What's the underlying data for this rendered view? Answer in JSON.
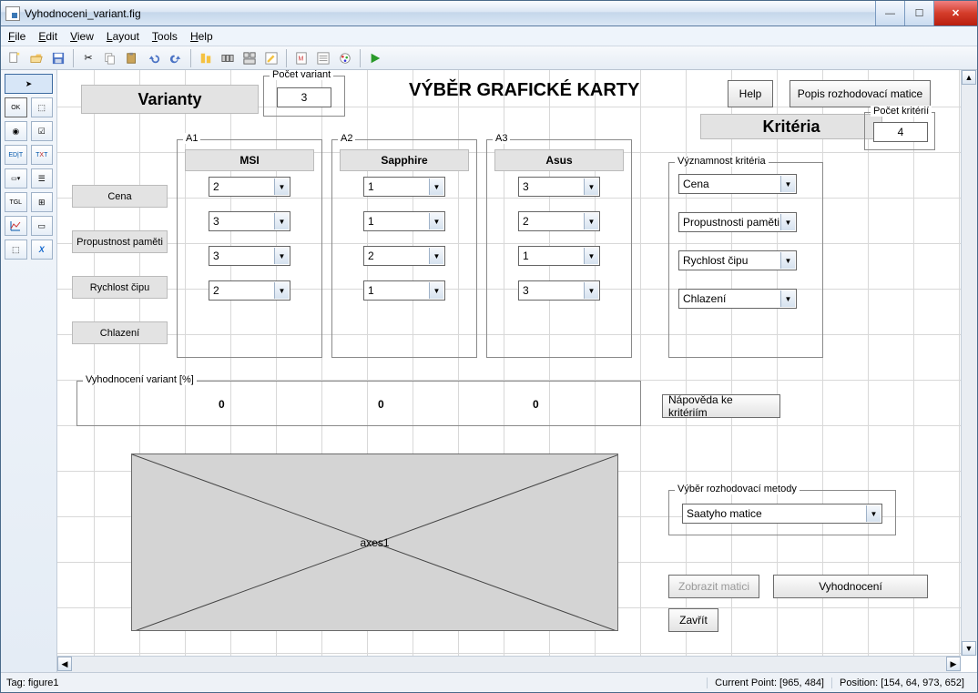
{
  "window": {
    "title": "Vyhodnoceni_variant.fig"
  },
  "menus": {
    "file": "File",
    "edit": "Edit",
    "view": "View",
    "layout": "Layout",
    "tools": "Tools",
    "help": "Help"
  },
  "header": {
    "varianty_label": "Varianty",
    "kriteria_label": "Kritéria",
    "pocet_variant_legend": "Počet variant",
    "pocet_variant_value": "3",
    "pocet_kriterii_legend": "Počet kritérií",
    "pocet_kriterii_value": "4",
    "main_title": "VÝBĚR GRAFICKÉ KARTY",
    "help_btn": "Help",
    "popis_btn": "Popis rozhodovací matice"
  },
  "rows": {
    "r1": "Cena",
    "r2": "Propustnost paměti",
    "r3": "Rychlost čipu",
    "r4": "Chlazení"
  },
  "a1": {
    "legend": "A1",
    "name": "MSI",
    "v": [
      "2",
      "3",
      "3",
      "2"
    ]
  },
  "a2": {
    "legend": "A2",
    "name": "Sapphire",
    "v": [
      "1",
      "1",
      "2",
      "1"
    ]
  },
  "a3": {
    "legend": "A3",
    "name": "Asus",
    "v": [
      "3",
      "2",
      "1",
      "3"
    ]
  },
  "signif": {
    "legend": "Významnost kritéria",
    "items": [
      "Cena",
      "Propustnosti paměti",
      "Rychlost čipu",
      "Chlazení"
    ]
  },
  "vyh": {
    "legend": "Vyhodnocení variant [%]",
    "vals": [
      "0",
      "0",
      "0"
    ]
  },
  "napoveda_btn": "Nápověda ke kritériím",
  "method": {
    "legend": "Výběr rozhodovací metody",
    "value": "Saatyho matice"
  },
  "buttons": {
    "zobrazit": "Zobrazit matici",
    "vyhod": "Vyhodnocení",
    "zavrit": "Zavřít"
  },
  "axes_label": "axes1",
  "status": {
    "tag": "Tag: figure1",
    "point": "Current Point:  [965, 484]",
    "pos": "Position: [154, 64, 973, 652]"
  }
}
